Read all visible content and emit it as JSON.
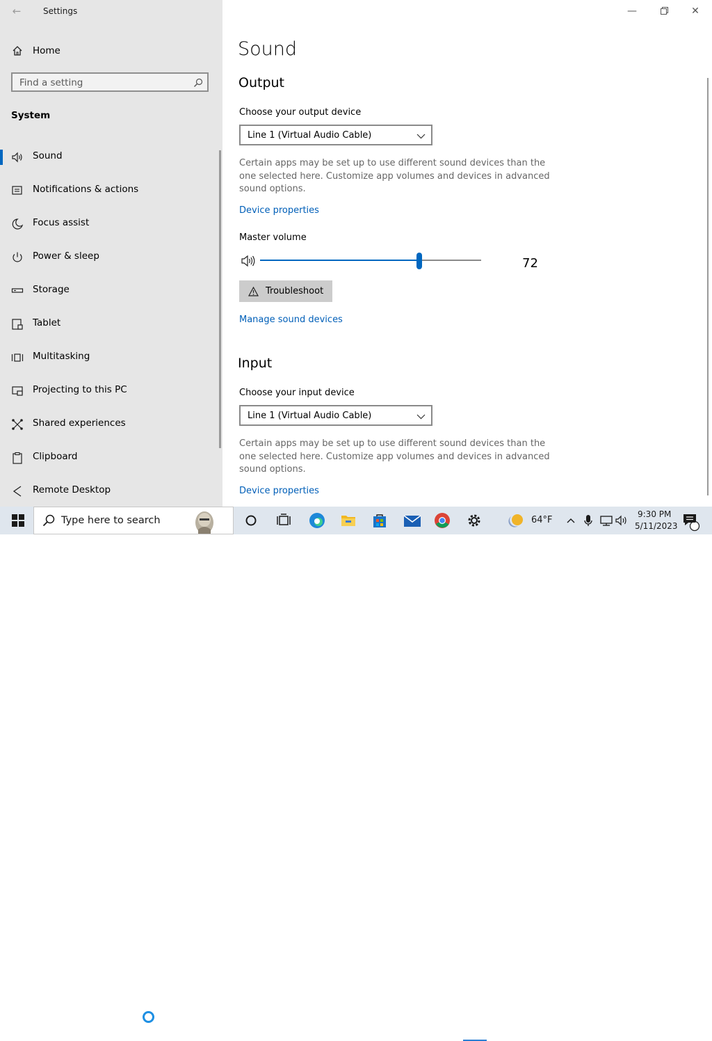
{
  "window": {
    "title": "Settings",
    "controls": {
      "minimize": "minimize-icon",
      "restore": "restore-icon",
      "close": "close-icon"
    }
  },
  "sidebar": {
    "home": "Home",
    "search_placeholder": "Find a setting",
    "section": "System",
    "items": [
      {
        "label": "Sound",
        "icon": "speaker-icon",
        "selected": true
      },
      {
        "label": "Notifications & actions",
        "icon": "notifications-icon"
      },
      {
        "label": "Focus assist",
        "icon": "moon-icon"
      },
      {
        "label": "Power & sleep",
        "icon": "power-icon"
      },
      {
        "label": "Storage",
        "icon": "storage-icon"
      },
      {
        "label": "Tablet",
        "icon": "tablet-icon"
      },
      {
        "label": "Multitasking",
        "icon": "multitasking-icon"
      },
      {
        "label": "Projecting to this PC",
        "icon": "projecting-icon"
      },
      {
        "label": "Shared experiences",
        "icon": "shared-icon"
      },
      {
        "label": "Clipboard",
        "icon": "clipboard-icon"
      },
      {
        "label": "Remote Desktop",
        "icon": "remote-desktop-icon"
      }
    ]
  },
  "main": {
    "title": "Sound",
    "output": {
      "heading": "Output",
      "device_label": "Choose your output device",
      "device_value": "Line 1 (Virtual Audio Cable)",
      "description": "Certain apps may be set up to use different sound devices than the one selected here. Customize app volumes and devices in advanced sound options.",
      "device_properties": "Device properties",
      "master_volume_label": "Master volume",
      "master_volume_value": "72",
      "master_volume_level": 72,
      "troubleshoot": "Troubleshoot",
      "manage_devices": "Manage sound devices"
    },
    "input": {
      "heading": "Input",
      "device_label": "Choose your input device",
      "device_value": "Line 1 (Virtual Audio Cable)",
      "description": "Certain apps may be set up to use different sound devices than the one selected here. Customize app volumes and devices in advanced sound options.",
      "device_properties": "Device properties"
    }
  },
  "taskbar": {
    "search_placeholder": "Type here to search",
    "weather_temp": "64°F",
    "time": "9:30 PM",
    "date": "5/11/2023",
    "notification_count": "1",
    "accent": "#0067c0"
  }
}
